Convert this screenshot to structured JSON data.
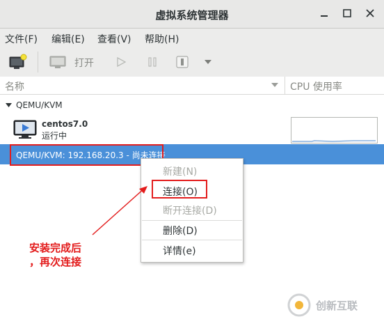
{
  "window": {
    "title": "虚拟系统管理器"
  },
  "menubar": {
    "items": [
      {
        "label": "文件(F)"
      },
      {
        "label": "编辑(E)"
      },
      {
        "label": "查看(V)"
      },
      {
        "label": "帮助(H)"
      }
    ]
  },
  "toolbar": {
    "open_label": "打开"
  },
  "columns": {
    "name": "名称",
    "cpu": "CPU 使用率"
  },
  "connections": [
    {
      "label": "QEMU/KVM",
      "vms": [
        {
          "name": "centos7.0",
          "status": "运行中"
        }
      ]
    },
    {
      "label": "QEMU/KVM: 192.168.20.3 - 尚未连接"
    }
  ],
  "context_menu": {
    "items": [
      {
        "label": "新建(N)",
        "enabled": false
      },
      {
        "label": "连接(O)",
        "enabled": true
      },
      {
        "label": "断开连接(D)",
        "enabled": false
      },
      {
        "label": "删除(D)",
        "enabled": true
      },
      {
        "label": "详情(e)",
        "enabled": true
      }
    ]
  },
  "annotation": {
    "line1": "安装完成后",
    "line2": "，再次连接"
  },
  "watermark": {
    "text": "创新互联"
  },
  "colors": {
    "selection": "#4a90d9",
    "annotation_red": "#e31c1c",
    "cpu_graph": "#6f9fd6"
  }
}
